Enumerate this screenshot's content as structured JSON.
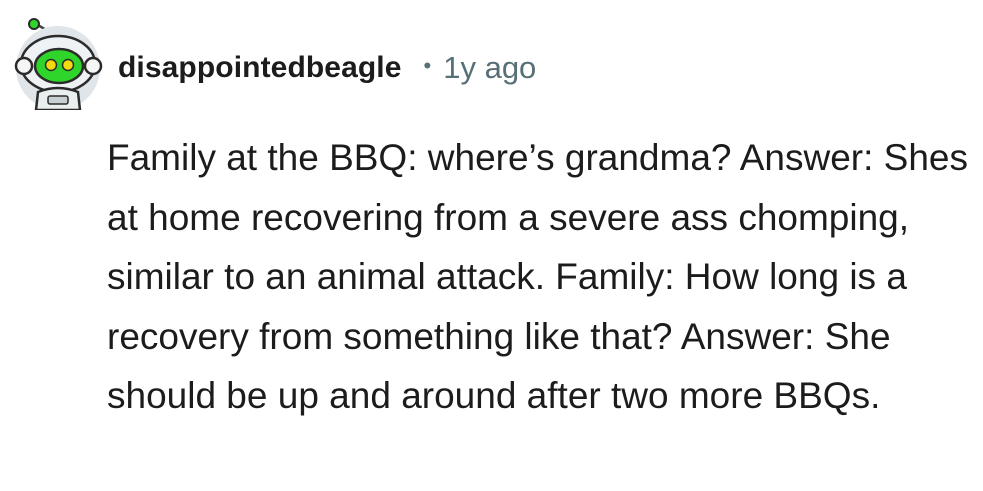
{
  "comment": {
    "author": "disappointedbeagle",
    "separator": "•",
    "timestamp": "1y ago",
    "avatar_icon": "snoo-astronaut-avatar-icon",
    "body": "Family at the BBQ: where’s grandma? Answer: Shes at home recovering from a severe ass chomping, similar to an animal attack. Family: How long is a recovery from something like that? Answer: She should be up and around after two more BBQs."
  },
  "colors": {
    "text_primary": "#1c1c1c",
    "text_secondary": "#576f76",
    "avatar_green": "#2fd52a",
    "background": "#ffffff"
  }
}
